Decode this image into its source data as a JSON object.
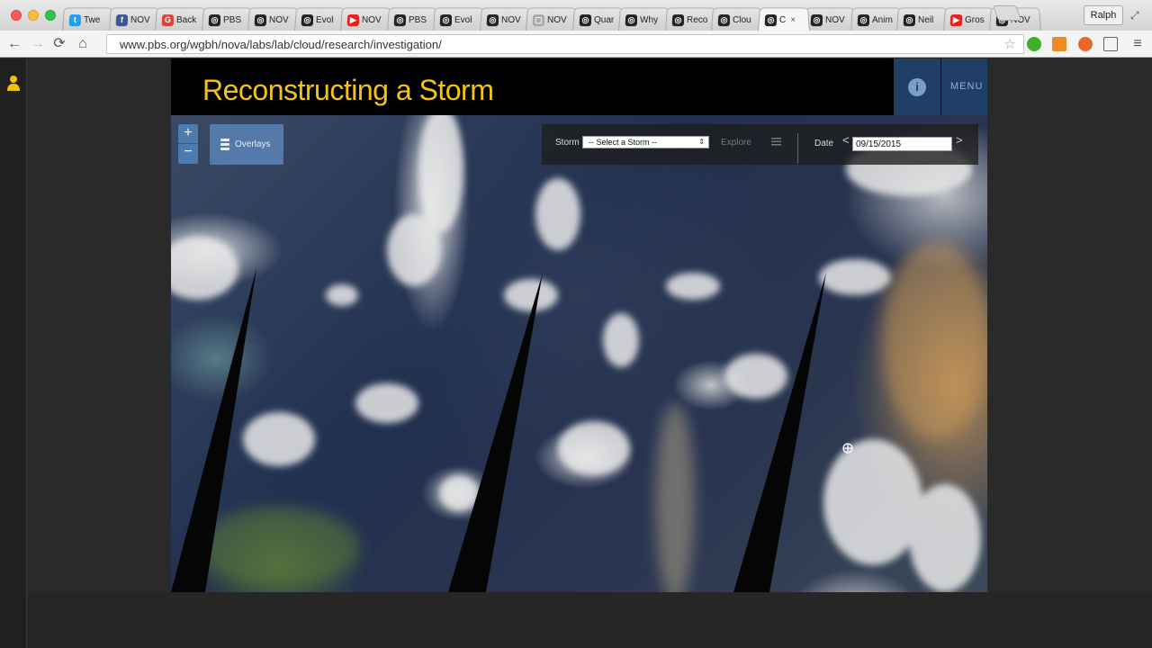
{
  "browser": {
    "tabs": [
      {
        "label": "Twe",
        "favicon_color": "#1da1f2",
        "favicon_glyph": "t"
      },
      {
        "label": "NOV",
        "favicon_color": "#3b5998",
        "favicon_glyph": "f"
      },
      {
        "label": "Back",
        "favicon_color": "#db4437",
        "favicon_glyph": "G"
      },
      {
        "label": "PBS",
        "favicon_color": "#222222",
        "favicon_glyph": "◎"
      },
      {
        "label": "NOV",
        "favicon_color": "#222222",
        "favicon_glyph": "◎"
      },
      {
        "label": "Evol",
        "favicon_color": "#222222",
        "favicon_glyph": "◎"
      },
      {
        "label": "NOV",
        "favicon_color": "#e62117",
        "favicon_glyph": "▶"
      },
      {
        "label": "PBS",
        "favicon_color": "#222222",
        "favicon_glyph": "◎"
      },
      {
        "label": "Evol",
        "favicon_color": "#222222",
        "favicon_glyph": "◎"
      },
      {
        "label": "NOV",
        "favicon_color": "#222222",
        "favicon_glyph": "◎"
      },
      {
        "label": "NOV",
        "favicon_color": "#aaaaaa",
        "favicon_glyph": "▢"
      },
      {
        "label": "Quar",
        "favicon_color": "#222222",
        "favicon_glyph": "◎"
      },
      {
        "label": "Why",
        "favicon_color": "#222222",
        "favicon_glyph": "◎"
      },
      {
        "label": "Reco",
        "favicon_color": "#222222",
        "favicon_glyph": "◎"
      },
      {
        "label": "Clou",
        "favicon_color": "#222222",
        "favicon_glyph": "◎"
      },
      {
        "label": "C",
        "favicon_color": "#222222",
        "favicon_glyph": "◎",
        "active": true
      },
      {
        "label": "NOV",
        "favicon_color": "#222222",
        "favicon_glyph": "◎"
      },
      {
        "label": "Anim",
        "favicon_color": "#222222",
        "favicon_glyph": "◎"
      },
      {
        "label": "Neil",
        "favicon_color": "#222222",
        "favicon_glyph": "◎"
      },
      {
        "label": "Gros",
        "favicon_color": "#e62117",
        "favicon_glyph": "▶"
      },
      {
        "label": "NOV",
        "favicon_color": "#222222",
        "favicon_glyph": "◎"
      }
    ],
    "tab_close_glyph": "×",
    "profile_name": "Ralph",
    "url": "www.pbs.org/wgbh/nova/labs/lab/cloud/research/investigation/",
    "back_glyph": "←",
    "forward_glyph": "→",
    "reload_glyph": "⟳",
    "home_glyph": "⌂",
    "star_glyph": "☆",
    "menu_glyph": "≡",
    "fullscreen_glyph": "⤢",
    "extension_colors": [
      "#3fae2a",
      "#f08a24",
      "#e86a2a",
      "#888888"
    ]
  },
  "app": {
    "title": "Reconstructing a Storm",
    "title_color": "#f0c419",
    "info_glyph": "i",
    "menu_label": "MENU",
    "zoom_in": "+",
    "zoom_out": "−",
    "overlays_label": "Overlays",
    "storm_label": "Storm",
    "storm_select_value": "-- Select a Storm --",
    "storm_select_arrow": "⇕",
    "explore_label": "Explore",
    "date_label": "Date",
    "date_prev": "<",
    "date_next": ">",
    "date_value": "09/15/2015",
    "accent_blue": "#1f3f66"
  }
}
